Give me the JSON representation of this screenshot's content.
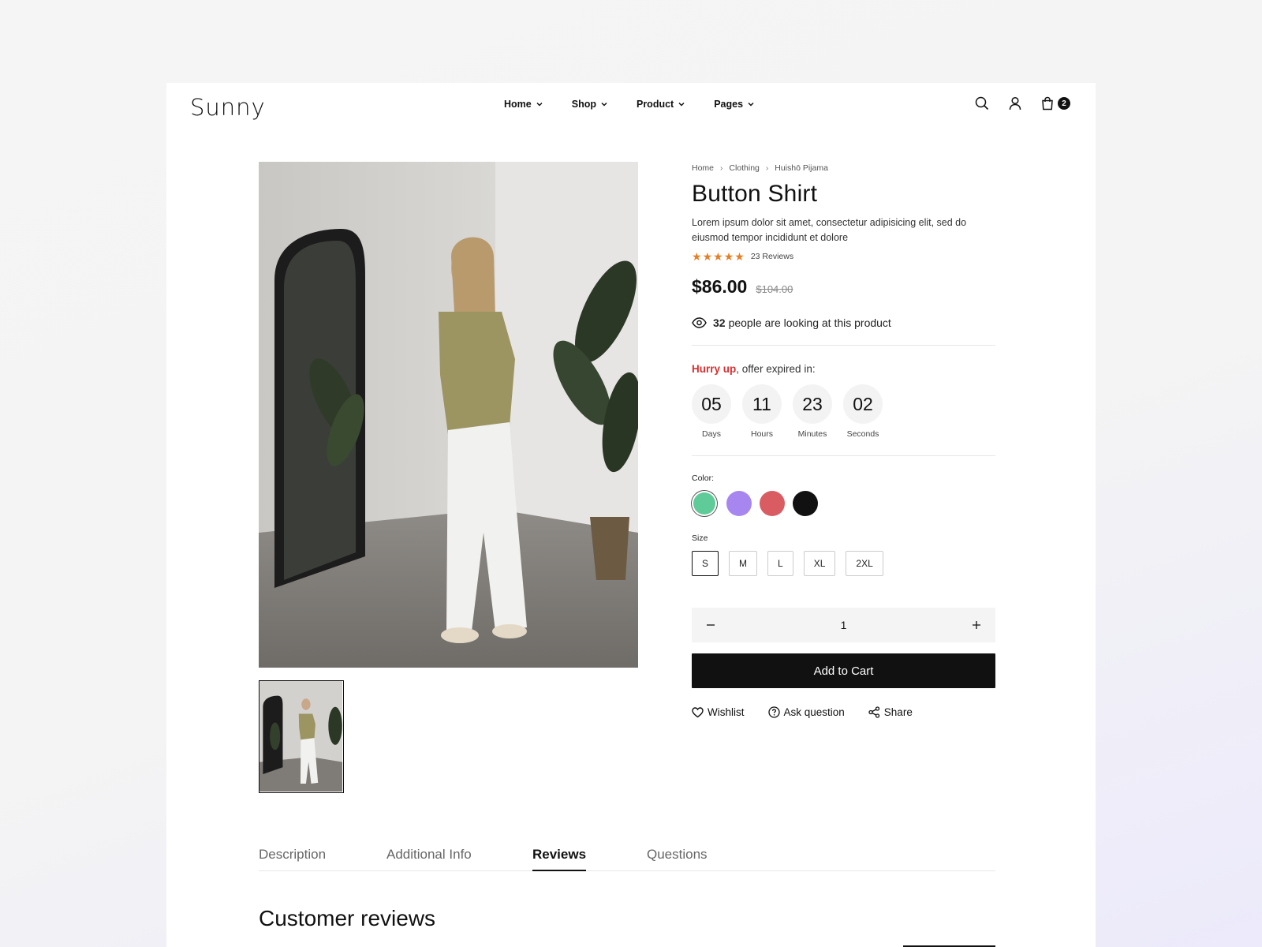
{
  "brand": {
    "logo": "Sunny"
  },
  "nav": {
    "items": [
      {
        "label": "Home"
      },
      {
        "label": "Shop"
      },
      {
        "label": "Product"
      },
      {
        "label": "Pages"
      }
    ]
  },
  "header": {
    "cart_count": "2",
    "icons": [
      "search-icon",
      "user-icon",
      "shopping-bag-icon"
    ]
  },
  "breadcrumb": {
    "items": [
      "Home",
      "Clothing",
      "Huishō Pijama"
    ]
  },
  "product": {
    "title": "Button Shirt",
    "description": "Lorem ipsum dolor sit amet, consectetur adipisicing elit, sed do eiusmod tempor incididunt et dolore",
    "rating": 5,
    "reviews_label": "23 Reviews",
    "price": "$86.00",
    "old_price": "$104.00",
    "viewers_count": "32",
    "viewers_text": "people are looking at this product"
  },
  "offer": {
    "hurry": "Hurry up",
    "rest": ", offer expired in:",
    "countdown": [
      {
        "value": "05",
        "label": "Days"
      },
      {
        "value": "11",
        "label": "Hours"
      },
      {
        "value": "23",
        "label": "Minutes"
      },
      {
        "value": "02",
        "label": "Seconds"
      }
    ]
  },
  "color": {
    "label": "Color:",
    "options": [
      {
        "name": "green",
        "hex": "#5ecb98",
        "selected": true
      },
      {
        "name": "purple",
        "hex": "#a786f0",
        "selected": false
      },
      {
        "name": "red",
        "hex": "#d95c63",
        "selected": false
      },
      {
        "name": "black",
        "hex": "#111111",
        "selected": false
      }
    ]
  },
  "size": {
    "label": "Size",
    "options": [
      "S",
      "M",
      "L",
      "XL",
      "2XL"
    ],
    "selected": "S"
  },
  "quantity": {
    "value": "1"
  },
  "cart": {
    "add_label": "Add to Cart"
  },
  "actions": {
    "wishlist": "Wishlist",
    "ask": "Ask question",
    "share": "Share"
  },
  "tabs": {
    "items": [
      "Description",
      "Additional Info",
      "Reviews",
      "Questions"
    ],
    "active": "Reviews"
  },
  "reviews": {
    "title": "Customer reviews"
  }
}
